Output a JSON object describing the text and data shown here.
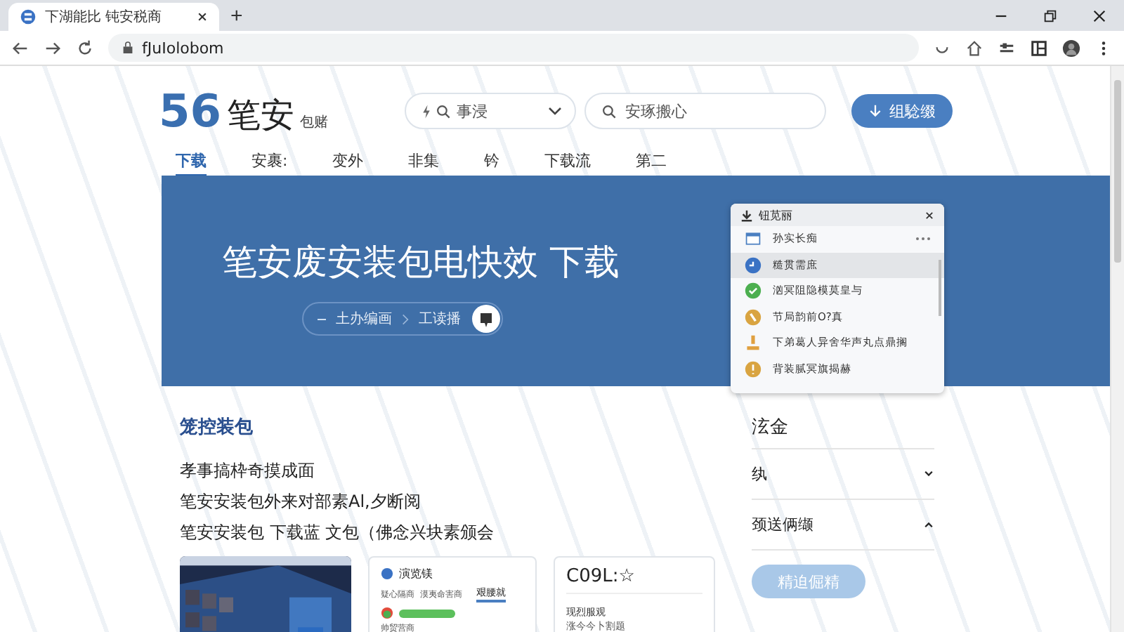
{
  "browser": {
    "tab_title": "下湖能比 钝安税商",
    "new_tab": "+",
    "url": "fJuIolobom"
  },
  "header": {
    "logo_number": "56",
    "logo_name": "笔安",
    "logo_suffix": "包赌",
    "category_placeholder": "事浸",
    "search_placeholder": "安琢搬心",
    "download_button": "组騐缀"
  },
  "nav": [
    {
      "label": "下载",
      "selected": true
    },
    {
      "label": "安裹:",
      "selected": false
    },
    {
      "label": "变外",
      "selected": false
    },
    {
      "label": "非集",
      "selected": false
    },
    {
      "label": "钤",
      "selected": false
    },
    {
      "label": "下载流",
      "selected": false
    },
    {
      "label": "第二",
      "selected": false
    }
  ],
  "banner": {
    "title": "笔安废安装包电快效 下载",
    "breadcrumb": [
      "土办编画",
      "工读播"
    ]
  },
  "popup": {
    "title": "钮苋丽",
    "items": [
      {
        "kind": "window",
        "label": "孙实长痴",
        "selected": false,
        "color": "#4a7fc1"
      },
      {
        "kind": "clock",
        "label": "糙贯需庶",
        "selected": true,
        "color": "#3a72c4"
      },
      {
        "kind": "check",
        "label": "汹冥阻隐模莫皇与",
        "selected": false,
        "color": "#4caf50"
      },
      {
        "kind": "phone",
        "label": "节局韵前O?真",
        "selected": false,
        "color": "#d9a441"
      },
      {
        "kind": "download",
        "label": "下弟葛人异舍华声丸点鼎搁",
        "selected": false,
        "color": "#e0a040"
      },
      {
        "kind": "info",
        "label": "背装腻冥旗揭赫",
        "selected": false,
        "color": "#d9a441"
      }
    ]
  },
  "section": {
    "heading": "笼控装包",
    "lines": [
      "孝事搞枠奇摸成面",
      "笔安安装包外来对部素Al,夕断阅",
      "笔安安装包  下载蓝 文包（佛念兴块素颁会"
    ]
  },
  "side_menu": {
    "title": "泫金",
    "items": [
      {
        "label": "纨",
        "expanded": false
      },
      {
        "label": "颈送俩缬",
        "expanded": true
      }
    ],
    "button": "精迫倔精"
  },
  "previews": [
    {
      "kind": "picture"
    },
    {
      "kind": "app",
      "title": "演览镁",
      "tabs": [
        "疑心隔商",
        "漠夷命害商"
      ],
      "active_tab": "艰腰就",
      "row": "帅贸营商"
    },
    {
      "kind": "text",
      "title": "C09L:☆",
      "label": "现烈服观",
      "sub": "涨今今卜割题"
    }
  ]
}
